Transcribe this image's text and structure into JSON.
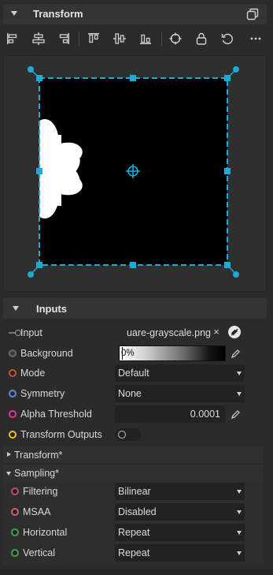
{
  "panel": {
    "title": "Transform"
  },
  "toolbar": {
    "buttons": [
      {
        "name": "align-left-icon"
      },
      {
        "name": "align-center-horizontal-icon"
      },
      {
        "name": "align-right-icon"
      },
      {
        "name": "align-top-icon"
      },
      {
        "name": "align-center-vertical-icon"
      },
      {
        "name": "align-bottom-icon"
      },
      {
        "name": "crosshair-icon"
      },
      {
        "name": "lock-icon"
      },
      {
        "name": "reset-icon"
      },
      {
        "name": "more-icon"
      }
    ]
  },
  "colors": {
    "accent": "#1fa9d6",
    "panel_bg": "#2b2b2b",
    "header_bg": "#343434",
    "field_bg": "#222222"
  },
  "inputs": {
    "title": "Inputs",
    "input": {
      "label": "Input",
      "value": "uare-grayscale.png",
      "clear": "×"
    },
    "background": {
      "label": "Background",
      "value": "0%"
    },
    "mode": {
      "label": "Mode",
      "value": "Default",
      "socket_color": "#c0563a"
    },
    "symmetry": {
      "label": "Symmetry",
      "value": "None",
      "socket_color": "#5b8fd6"
    },
    "alpha_threshold": {
      "label": "Alpha Threshold",
      "value": "0.0001",
      "socket_color": "#e0379a"
    },
    "transform_outputs": {
      "label": "Transform Outputs",
      "value": false,
      "socket_color": "#e8c31a"
    },
    "transform_group": {
      "label": "Transform*"
    },
    "sampling_group": {
      "label": "Sampling*"
    },
    "filtering": {
      "label": "Filtering",
      "value": "Bilinear",
      "socket_color": "#c24a6d"
    },
    "msaa": {
      "label": "MSAA",
      "value": "Disabled",
      "socket_color": "#d95c6a"
    },
    "horizontal": {
      "label": "Horizontal",
      "value": "Repeat",
      "socket_color": "#3fa33f"
    },
    "vertical": {
      "label": "Vertical",
      "value": "Repeat",
      "socket_color": "#3fa33f"
    }
  }
}
